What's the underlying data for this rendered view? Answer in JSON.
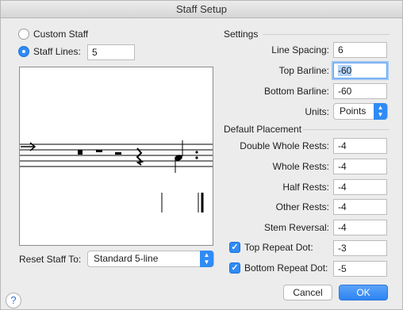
{
  "window": {
    "title": "Staff Setup"
  },
  "staff_type": {
    "custom_label": "Custom Staff",
    "lines_label": "Staff Lines:",
    "lines_value": "5",
    "selected": "staff_lines"
  },
  "settings": {
    "title": "Settings",
    "line_spacing_label": "Line Spacing:",
    "line_spacing_value": "6",
    "top_barline_label": "Top Barline:",
    "top_barline_value": "-60",
    "bottom_barline_label": "Bottom Barline:",
    "bottom_barline_value": "-60",
    "units_label": "Units:",
    "units_value": "Points"
  },
  "placement": {
    "title": "Default Placement",
    "double_whole_label": "Double Whole Rests:",
    "double_whole_value": "-4",
    "whole_label": "Whole Rests:",
    "whole_value": "-4",
    "half_label": "Half Rests:",
    "half_value": "-4",
    "other_label": "Other Rests:",
    "other_value": "-4",
    "stem_label": "Stem Reversal:",
    "stem_value": "-4",
    "top_repeat_label": "Top Repeat Dot:",
    "top_repeat_value": "-3",
    "bottom_repeat_label": "Bottom Repeat Dot:",
    "bottom_repeat_value": "-5",
    "top_repeat_checked": true,
    "bottom_repeat_checked": true
  },
  "reset": {
    "label": "Reset Staff To:",
    "value": "Standard 5-line"
  },
  "buttons": {
    "cancel": "Cancel",
    "ok": "OK",
    "help": "?"
  },
  "colors": {
    "accent": "#2f8bf6",
    "window_bg": "#ececec"
  },
  "icons": {
    "radio": "radio-icon",
    "checkbox": "checkmark-icon",
    "popup_arrows": "up-down-chevron-icon",
    "help": "question-icon"
  }
}
